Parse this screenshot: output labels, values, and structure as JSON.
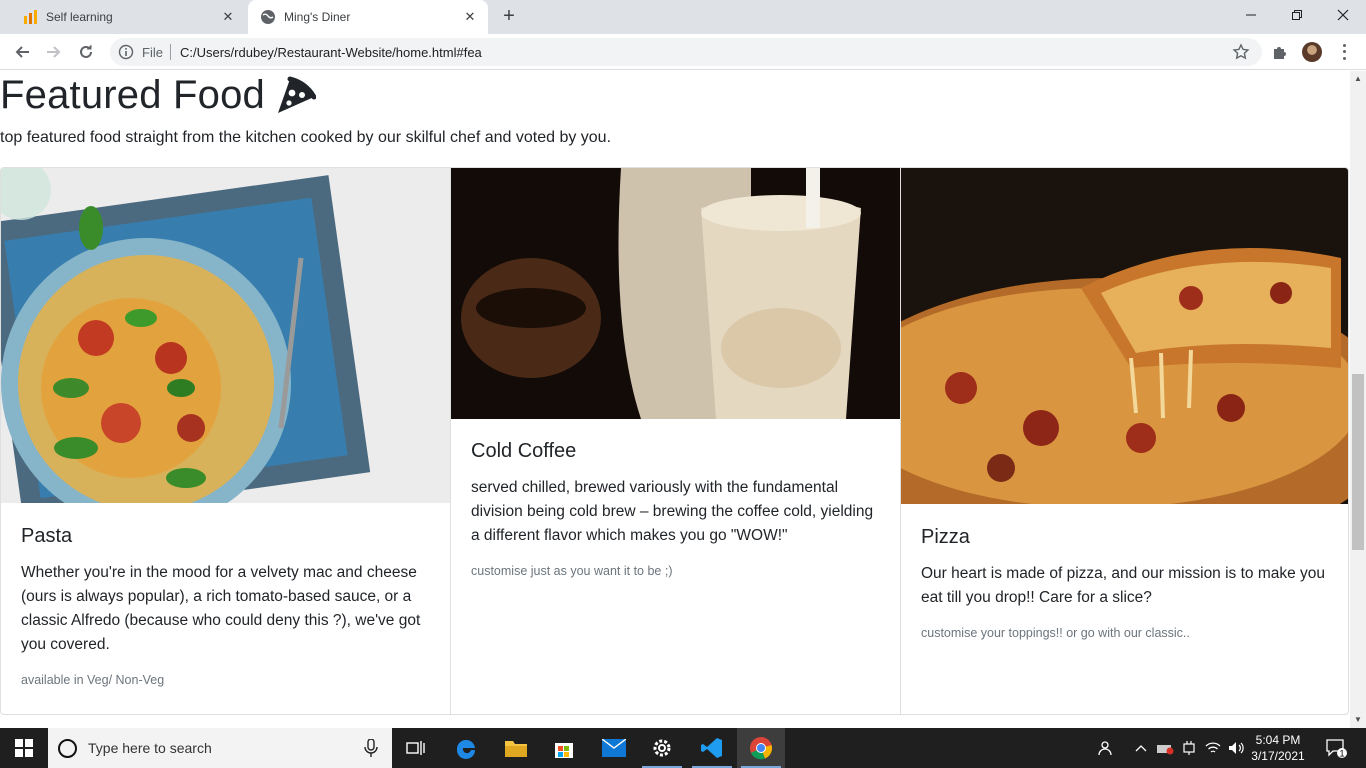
{
  "browser": {
    "tabs": [
      {
        "label": "Self learning",
        "active": false
      },
      {
        "label": "Ming's Diner",
        "active": true
      }
    ],
    "omnibox": {
      "scheme_label": "File",
      "url": "C:/Users/rdubey/Restaurant-Website/home.html#fea"
    }
  },
  "page": {
    "heading": "Featured Food",
    "heading_icon": "pizza-slice-icon",
    "subtitle": "top featured food straight from the kitchen cooked by our skilful chef and voted by you.",
    "cards": [
      {
        "title": "Pasta",
        "text": "Whether you're in the mood for a velvety mac and cheese (ours is always popular), a rich tomato-based sauce, or a classic Alfredo (because who could deny this ?), we've got you covered.",
        "note": "available in Veg/ Non-Veg",
        "image": "pasta-photo"
      },
      {
        "title": "Cold Coffee",
        "text": "served chilled, brewed variously with the fundamental division being cold brew – brewing the coffee cold, yielding a different flavor which makes you go \"WOW!\"",
        "note": "customise just as you want it to be ;)",
        "image": "cold-coffee-photo"
      },
      {
        "title": "Pizza",
        "text": "Our heart is made of pizza, and our mission is to make you eat till you drop!! Care for a slice?",
        "note": "customise your toppings!! or go with our classic..",
        "image": "pizza-photo"
      }
    ]
  },
  "taskbar": {
    "search_placeholder": "Type here to search",
    "time": "5:04 PM",
    "date": "3/17/2021",
    "notification_count": "1"
  },
  "colors": {
    "tab_strip": "#dee1e6",
    "taskbar": "#1f1f1f",
    "text": "#212529",
    "muted": "#6c757d"
  }
}
